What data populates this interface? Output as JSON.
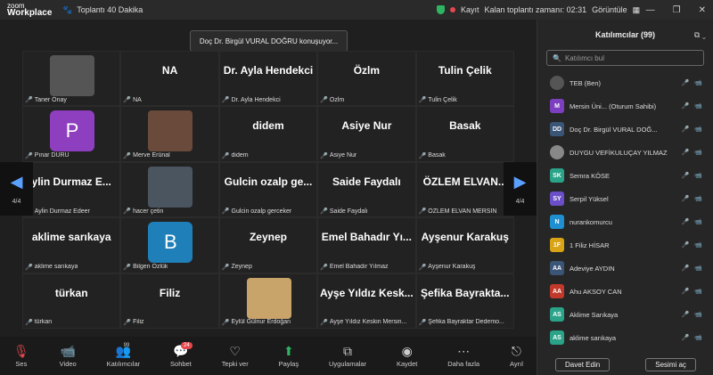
{
  "app": {
    "logo_top": "zoom",
    "logo_bottom": "Workplace",
    "meeting_title": "Toplantı 40 Dakika",
    "recording": "Kayıt",
    "remaining": "Kalan toplantı zamanı: 02:31",
    "view": "Görüntüle"
  },
  "speaking": "Doç Dr. Birgül VURAL DOĞRU konuşuyor...",
  "page_indicator_left": "4/4",
  "page_indicator_right": "4/4",
  "tiles": [
    {
      "big": "",
      "label": "Taner Önay",
      "type": "photo",
      "color": "#555"
    },
    {
      "big": "NA",
      "label": "NA"
    },
    {
      "big": "Dr. Ayla Hendekci",
      "label": "Dr. Ayla Hendekci"
    },
    {
      "big": "Özlm",
      "label": "Özlm"
    },
    {
      "big": "Tulin Çelik",
      "label": "Tulin Çelik"
    },
    {
      "big": "",
      "label": "Pınar DURU",
      "type": "avatar",
      "initial": "P",
      "color": "#8e3fbf"
    },
    {
      "big": "",
      "label": "Merve Erünal",
      "type": "photo",
      "color": "#6a4a3a"
    },
    {
      "big": "didem",
      "label": "didem"
    },
    {
      "big": "Asiye Nur",
      "label": "Asiye Nur"
    },
    {
      "big": "Basak",
      "label": "Basak"
    },
    {
      "big": "ylin Durmaz E...",
      "label": "Aylin Durmaz Edeer"
    },
    {
      "big": "",
      "label": "hacer çetin",
      "type": "photo",
      "color": "#4a5560"
    },
    {
      "big": "Gulcin  ozalp ge...",
      "label": "Gulcin  ozalp gerceker"
    },
    {
      "big": "Saide Faydalı",
      "label": "Saide Faydalı"
    },
    {
      "big": "ÖZLEM  ELVAN...",
      "label": "ÖZLEM ELVAN MERSİN"
    },
    {
      "big": "aklime sarıkaya",
      "label": "aklime sarıkaya"
    },
    {
      "big": "",
      "label": "Bilgen Özlük",
      "type": "avatar",
      "initial": "B",
      "color": "#1f7fb8"
    },
    {
      "big": "Zeynep",
      "label": "Zeynep"
    },
    {
      "big": "Emel  Bahadır Yı...",
      "label": "Emel Bahadır Yılmaz"
    },
    {
      "big": "Ayşenur Karakuş",
      "label": "Ayşenur Karakuş"
    },
    {
      "big": "türkan",
      "label": "türkan"
    },
    {
      "big": "Filiz",
      "label": "Filiz"
    },
    {
      "big": "",
      "label": "Eylül Gülnur Erdoğan",
      "type": "photo",
      "color": "#c9a46a"
    },
    {
      "big": "Ayşe Yıldız Kesk...",
      "label": "Ayşe Yıldız Keskin Mersin..."
    },
    {
      "big": "Şefika Bayrakta...",
      "label": "Şefika Bayraktar Dedemo..."
    }
  ],
  "toolbar": [
    {
      "name": "mic",
      "label": "Ses",
      "icon": "🎙",
      "color": "#e5484d"
    },
    {
      "name": "video",
      "label": "Video",
      "icon": "📹",
      "color": "#e5484d"
    },
    {
      "name": "participants",
      "label": "Katılımcılar",
      "icon": "👥",
      "count": "99"
    },
    {
      "name": "chat",
      "label": "Sohbet",
      "icon": "💬",
      "badge": "24"
    },
    {
      "name": "reactions",
      "label": "Tepki ver",
      "icon": "♡"
    },
    {
      "name": "share",
      "label": "Paylaş",
      "icon": "⬆",
      "color": "#2fb463"
    },
    {
      "name": "apps",
      "label": "Uygulamalar",
      "icon": "⧉"
    },
    {
      "name": "record",
      "label": "Kaydet",
      "icon": "◉"
    },
    {
      "name": "more",
      "label": "Daha fazla",
      "icon": "⋯"
    },
    {
      "name": "leave",
      "label": "Ayrıl",
      "icon": "⎋"
    }
  ],
  "panel": {
    "title": "Katılımcılar (99)",
    "search_placeholder": "Katılımcı bul",
    "invite": "Davet Edin",
    "mute_all": "Sesimi aç",
    "people": [
      {
        "initials": "",
        "name": "TEB (Ben)",
        "color": "#555",
        "photo": true
      },
      {
        "initials": "M",
        "name": "Mersin Üni... (Oturum Sahibi)",
        "color": "#7b3fbf"
      },
      {
        "initials": "DD",
        "name": "Doç Dr. Birgül VURAL DOĞ...",
        "color": "#3b5577"
      },
      {
        "initials": "",
        "name": "DUYGU VEFİKULUÇAY YILMAZ",
        "color": "#888",
        "photo": true
      },
      {
        "initials": "SK",
        "name": "Semra KÖSE",
        "color": "#2aa388"
      },
      {
        "initials": "SY",
        "name": "Serpil Yüksel",
        "color": "#6b4fc8"
      },
      {
        "initials": "N",
        "name": "nurankomurcu",
        "color": "#1f8fd0"
      },
      {
        "initials": "1F",
        "name": "1 Filiz HİSAR",
        "color": "#d9a316"
      },
      {
        "initials": "AA",
        "name": "Adeviye AYDIN",
        "color": "#3b5577"
      },
      {
        "initials": "AA",
        "name": "Ahu AKSOY CAN",
        "color": "#c0392b"
      },
      {
        "initials": "AS",
        "name": "Aklime Sarıkaya",
        "color": "#2aa388"
      },
      {
        "initials": "AS",
        "name": "aklime sarıkaya",
        "color": "#2aa388"
      }
    ]
  }
}
